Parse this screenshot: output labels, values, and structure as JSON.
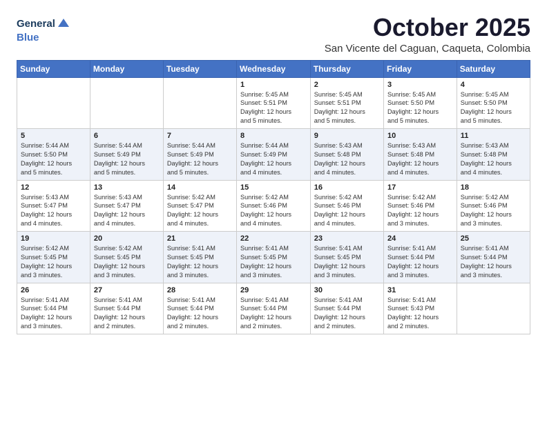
{
  "header": {
    "logo_line1": "General",
    "logo_line2": "Blue",
    "month": "October 2025",
    "location": "San Vicente del Caguan, Caqueta, Colombia"
  },
  "days_of_week": [
    "Sunday",
    "Monday",
    "Tuesday",
    "Wednesday",
    "Thursday",
    "Friday",
    "Saturday"
  ],
  "weeks": [
    [
      {
        "day": "",
        "content": ""
      },
      {
        "day": "",
        "content": ""
      },
      {
        "day": "",
        "content": ""
      },
      {
        "day": "1",
        "content": "Sunrise: 5:45 AM\nSunset: 5:51 PM\nDaylight: 12 hours\nand 5 minutes."
      },
      {
        "day": "2",
        "content": "Sunrise: 5:45 AM\nSunset: 5:51 PM\nDaylight: 12 hours\nand 5 minutes."
      },
      {
        "day": "3",
        "content": "Sunrise: 5:45 AM\nSunset: 5:50 PM\nDaylight: 12 hours\nand 5 minutes."
      },
      {
        "day": "4",
        "content": "Sunrise: 5:45 AM\nSunset: 5:50 PM\nDaylight: 12 hours\nand 5 minutes."
      }
    ],
    [
      {
        "day": "5",
        "content": "Sunrise: 5:44 AM\nSunset: 5:50 PM\nDaylight: 12 hours\nand 5 minutes."
      },
      {
        "day": "6",
        "content": "Sunrise: 5:44 AM\nSunset: 5:49 PM\nDaylight: 12 hours\nand 5 minutes."
      },
      {
        "day": "7",
        "content": "Sunrise: 5:44 AM\nSunset: 5:49 PM\nDaylight: 12 hours\nand 5 minutes."
      },
      {
        "day": "8",
        "content": "Sunrise: 5:44 AM\nSunset: 5:49 PM\nDaylight: 12 hours\nand 4 minutes."
      },
      {
        "day": "9",
        "content": "Sunrise: 5:43 AM\nSunset: 5:48 PM\nDaylight: 12 hours\nand 4 minutes."
      },
      {
        "day": "10",
        "content": "Sunrise: 5:43 AM\nSunset: 5:48 PM\nDaylight: 12 hours\nand 4 minutes."
      },
      {
        "day": "11",
        "content": "Sunrise: 5:43 AM\nSunset: 5:48 PM\nDaylight: 12 hours\nand 4 minutes."
      }
    ],
    [
      {
        "day": "12",
        "content": "Sunrise: 5:43 AM\nSunset: 5:47 PM\nDaylight: 12 hours\nand 4 minutes."
      },
      {
        "day": "13",
        "content": "Sunrise: 5:43 AM\nSunset: 5:47 PM\nDaylight: 12 hours\nand 4 minutes."
      },
      {
        "day": "14",
        "content": "Sunrise: 5:42 AM\nSunset: 5:47 PM\nDaylight: 12 hours\nand 4 minutes."
      },
      {
        "day": "15",
        "content": "Sunrise: 5:42 AM\nSunset: 5:46 PM\nDaylight: 12 hours\nand 4 minutes."
      },
      {
        "day": "16",
        "content": "Sunrise: 5:42 AM\nSunset: 5:46 PM\nDaylight: 12 hours\nand 4 minutes."
      },
      {
        "day": "17",
        "content": "Sunrise: 5:42 AM\nSunset: 5:46 PM\nDaylight: 12 hours\nand 3 minutes."
      },
      {
        "day": "18",
        "content": "Sunrise: 5:42 AM\nSunset: 5:46 PM\nDaylight: 12 hours\nand 3 minutes."
      }
    ],
    [
      {
        "day": "19",
        "content": "Sunrise: 5:42 AM\nSunset: 5:45 PM\nDaylight: 12 hours\nand 3 minutes."
      },
      {
        "day": "20",
        "content": "Sunrise: 5:42 AM\nSunset: 5:45 PM\nDaylight: 12 hours\nand 3 minutes."
      },
      {
        "day": "21",
        "content": "Sunrise: 5:41 AM\nSunset: 5:45 PM\nDaylight: 12 hours\nand 3 minutes."
      },
      {
        "day": "22",
        "content": "Sunrise: 5:41 AM\nSunset: 5:45 PM\nDaylight: 12 hours\nand 3 minutes."
      },
      {
        "day": "23",
        "content": "Sunrise: 5:41 AM\nSunset: 5:45 PM\nDaylight: 12 hours\nand 3 minutes."
      },
      {
        "day": "24",
        "content": "Sunrise: 5:41 AM\nSunset: 5:44 PM\nDaylight: 12 hours\nand 3 minutes."
      },
      {
        "day": "25",
        "content": "Sunrise: 5:41 AM\nSunset: 5:44 PM\nDaylight: 12 hours\nand 3 minutes."
      }
    ],
    [
      {
        "day": "26",
        "content": "Sunrise: 5:41 AM\nSunset: 5:44 PM\nDaylight: 12 hours\nand 3 minutes."
      },
      {
        "day": "27",
        "content": "Sunrise: 5:41 AM\nSunset: 5:44 PM\nDaylight: 12 hours\nand 2 minutes."
      },
      {
        "day": "28",
        "content": "Sunrise: 5:41 AM\nSunset: 5:44 PM\nDaylight: 12 hours\nand 2 minutes."
      },
      {
        "day": "29",
        "content": "Sunrise: 5:41 AM\nSunset: 5:44 PM\nDaylight: 12 hours\nand 2 minutes."
      },
      {
        "day": "30",
        "content": "Sunrise: 5:41 AM\nSunset: 5:44 PM\nDaylight: 12 hours\nand 2 minutes."
      },
      {
        "day": "31",
        "content": "Sunrise: 5:41 AM\nSunset: 5:43 PM\nDaylight: 12 hours\nand 2 minutes."
      },
      {
        "day": "",
        "content": ""
      }
    ]
  ]
}
